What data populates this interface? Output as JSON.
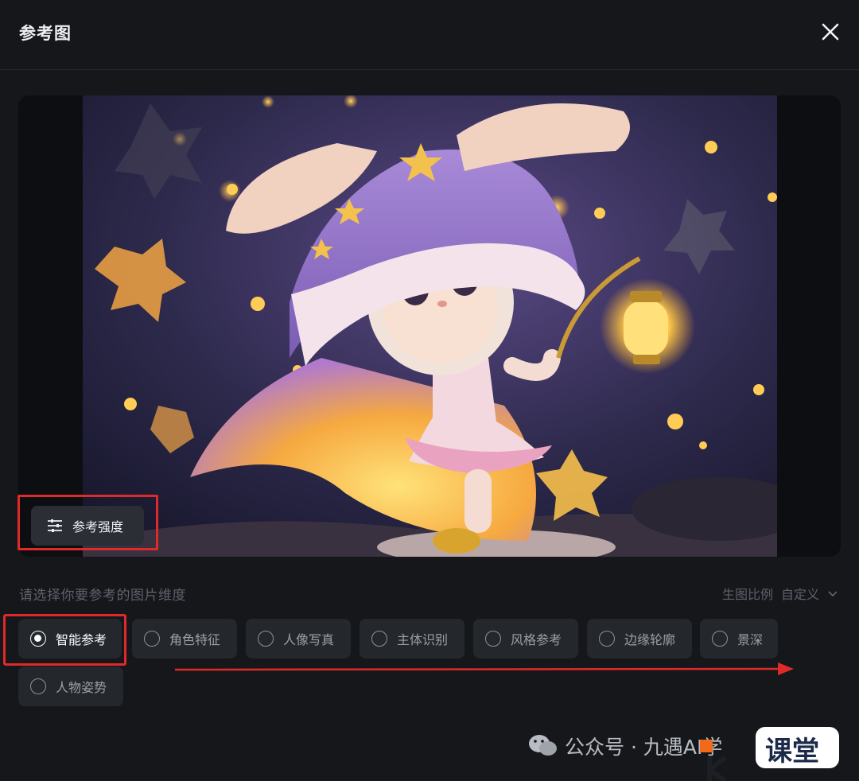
{
  "header": {
    "title": "参考图"
  },
  "preview": {
    "strength_button": "参考强度"
  },
  "dimension": {
    "prompt": "请选择你要参考的图片维度",
    "ratio_label": "生图比例",
    "ratio_value": "自定义"
  },
  "options": [
    {
      "label": "智能参考",
      "selected": true
    },
    {
      "label": "角色特征",
      "selected": false
    },
    {
      "label": "人像写真",
      "selected": false
    },
    {
      "label": "主体识别",
      "selected": false
    },
    {
      "label": "风格参考",
      "selected": false
    },
    {
      "label": "边缘轮廓",
      "selected": false
    },
    {
      "label": "景深",
      "selected": false
    },
    {
      "label": "人物姿势",
      "selected": false
    }
  ],
  "watermark": {
    "text": "公众号 · 九遇AI学",
    "logo_text": "课堂"
  },
  "colors": {
    "highlight": "#e02a2a",
    "background": "#15171b",
    "chip": "#24272c"
  }
}
